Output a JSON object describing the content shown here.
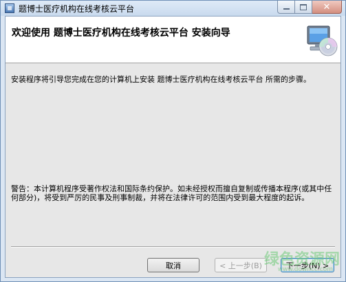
{
  "window": {
    "title": "题博士医疗机构在线考核云平台",
    "controls": {
      "minimize": "–",
      "maximize": "□",
      "close": "✕"
    }
  },
  "banner": {
    "heading": "欢迎使用  题博士医疗机构在线考核云平台  安装向导",
    "graphic_icon": "computer-cd-install-icon"
  },
  "body": {
    "intro": "安装程序将引导您完成在您的计算机上安装 题博士医疗机构在线考核云平台 所需的步骤。",
    "warning": "警告：本计算机程序受著作权法和国际条约保护。如未经授权而擅自复制或传播本程序(或其中任何部分)，将受到严厉的民事及刑事制裁，并将在法律许可的范围内受到最大程度的起诉。"
  },
  "buttons": {
    "cancel": "取消",
    "back": "< 上一步(B)",
    "next": "下一步(N) >"
  },
  "watermark": {
    "text": "绿色资源网",
    "url": "www.downcc.com"
  },
  "colors": {
    "title_bar": "#c9daee",
    "dialog_bg": "#e7e7e7",
    "banner_bg": "#ffffff",
    "close_button": "#d48f80",
    "watermark": "#6fcb7a"
  }
}
